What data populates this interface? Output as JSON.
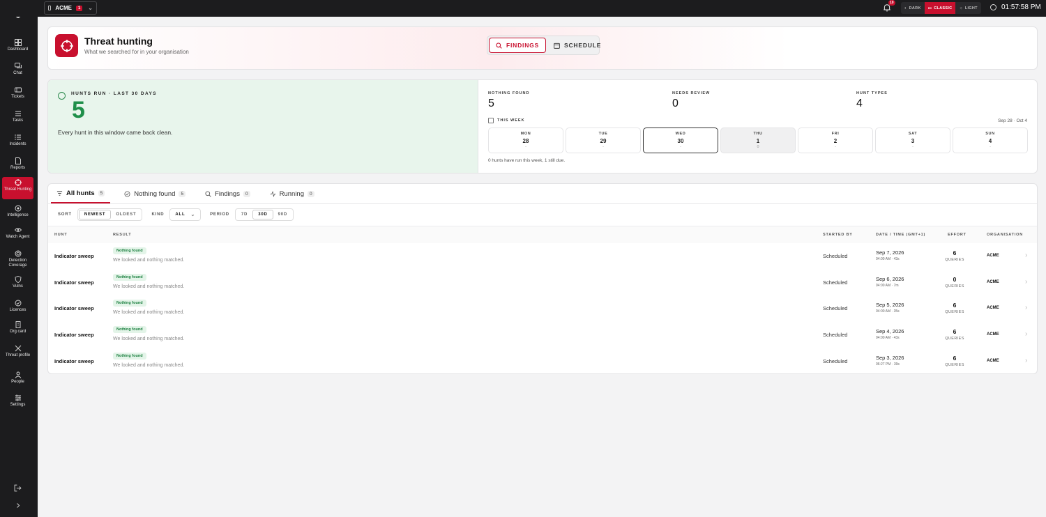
{
  "topbar": {
    "org_name": "ACME",
    "org_count": "1",
    "notification_count": "10",
    "theme_options": [
      "DARK",
      "CLASSIC",
      "LIGHT"
    ],
    "clock": "01:57:58 PM"
  },
  "sidebar": {
    "items": [
      {
        "label": "Dashboard",
        "icon": "grid-icon"
      },
      {
        "label": "Chat",
        "icon": "chat-icon"
      },
      {
        "label": "Tickets",
        "icon": "ticket-icon"
      },
      {
        "label": "Tasks",
        "icon": "tasks-icon"
      },
      {
        "label": "Incidents",
        "icon": "incidents-icon"
      },
      {
        "label": "Reports",
        "icon": "report-icon"
      },
      {
        "label": "Threat Hunting",
        "icon": "crosshair-icon"
      },
      {
        "label": "Intelligence",
        "icon": "intelligence-icon"
      },
      {
        "label": "Watch Agent",
        "icon": "eye-icon"
      },
      {
        "label": "Detection Coverage",
        "icon": "coverage-icon"
      },
      {
        "label": "Vulns",
        "icon": "shield-icon"
      },
      {
        "label": "Licences",
        "icon": "check-circle-icon"
      },
      {
        "label": "Org card",
        "icon": "building-icon"
      },
      {
        "label": "Threat profile",
        "icon": "profile-icon"
      },
      {
        "label": "People",
        "icon": "people-icon"
      },
      {
        "label": "Settings",
        "icon": "settings-icon"
      }
    ]
  },
  "header": {
    "title": "Threat hunting",
    "subtitle": "What we searched for in your organisation",
    "tabs": [
      "FINDINGS",
      "SCHEDULE"
    ]
  },
  "stats": {
    "hunts_run_label": "HUNTS RUN · LAST 30 DAYS",
    "hunts_run_value": "5",
    "hunts_note": "Every hunt in this window came back clean.",
    "nothing_found_label": "NOTHING FOUND",
    "nothing_found_value": "5",
    "needs_review_label": "NEEDS REVIEW",
    "needs_review_value": "0",
    "hunt_types_label": "HUNT TYPES",
    "hunt_types_value": "4",
    "this_week_label": "THIS WEEK",
    "week_range": "Sep 28 · Oct 4",
    "days": [
      {
        "name": "MON",
        "date": "28",
        "count": "-"
      },
      {
        "name": "TUE",
        "date": "29",
        "count": "-"
      },
      {
        "name": "WED",
        "date": "30",
        "count": "-"
      },
      {
        "name": "THU",
        "date": "1",
        "count": "0"
      },
      {
        "name": "FRI",
        "date": "2",
        "count": "-"
      },
      {
        "name": "SAT",
        "date": "3",
        "count": "-"
      },
      {
        "name": "SUN",
        "date": "4",
        "count": "-"
      }
    ],
    "week_note": "0 hunts have run this week, 1 still due."
  },
  "table": {
    "tabs": [
      {
        "label": "All hunts",
        "count": "5"
      },
      {
        "label": "Nothing found",
        "count": "5"
      },
      {
        "label": "Findings",
        "count": "0"
      },
      {
        "label": "Running",
        "count": "0"
      }
    ],
    "filters": {
      "sort_label": "SORT",
      "sort_options": [
        "NEWEST",
        "OLDEST"
      ],
      "kind_label": "KIND",
      "kind_value": "ALL",
      "period_label": "PERIOD",
      "period_options": [
        "7D",
        "30D",
        "90D"
      ]
    },
    "columns": [
      "HUNT",
      "RESULT",
      "STARTED BY",
      "DATE / TIME (GMT+1)",
      "EFFORT",
      "ORGANISATION"
    ],
    "rows": [
      {
        "hunt": "Indicator sweep",
        "result": "Nothing found",
        "desc": "We looked and nothing matched.",
        "started": "Scheduled",
        "date": "Sep 7, 2026",
        "time": "04:00 AM · 43s",
        "effort": "6",
        "unit": "QUERIES",
        "org": "ACME"
      },
      {
        "hunt": "Indicator sweep",
        "result": "Nothing found",
        "desc": "We looked and nothing matched.",
        "started": "Scheduled",
        "date": "Sep 6, 2026",
        "time": "04:00 AM · 7m",
        "effort": "0",
        "unit": "QUERIES",
        "org": "ACME"
      },
      {
        "hunt": "Indicator sweep",
        "result": "Nothing found",
        "desc": "We looked and nothing matched.",
        "started": "Scheduled",
        "date": "Sep 5, 2026",
        "time": "04:00 AM · 35s",
        "effort": "6",
        "unit": "QUERIES",
        "org": "ACME"
      },
      {
        "hunt": "Indicator sweep",
        "result": "Nothing found",
        "desc": "We looked and nothing matched.",
        "started": "Scheduled",
        "date": "Sep 4, 2026",
        "time": "04:00 AM · 43s",
        "effort": "6",
        "unit": "QUERIES",
        "org": "ACME"
      },
      {
        "hunt": "Indicator sweep",
        "result": "Nothing found",
        "desc": "We looked and nothing matched.",
        "started": "Scheduled",
        "date": "Sep 3, 2026",
        "time": "06:27 PM · 39s",
        "effort": "6",
        "unit": "QUERIES",
        "org": "ACME"
      }
    ]
  },
  "colors": {
    "accent": "#c8102e",
    "success": "#1f8f4a",
    "sidebar_bg": "#1c1c1e"
  }
}
